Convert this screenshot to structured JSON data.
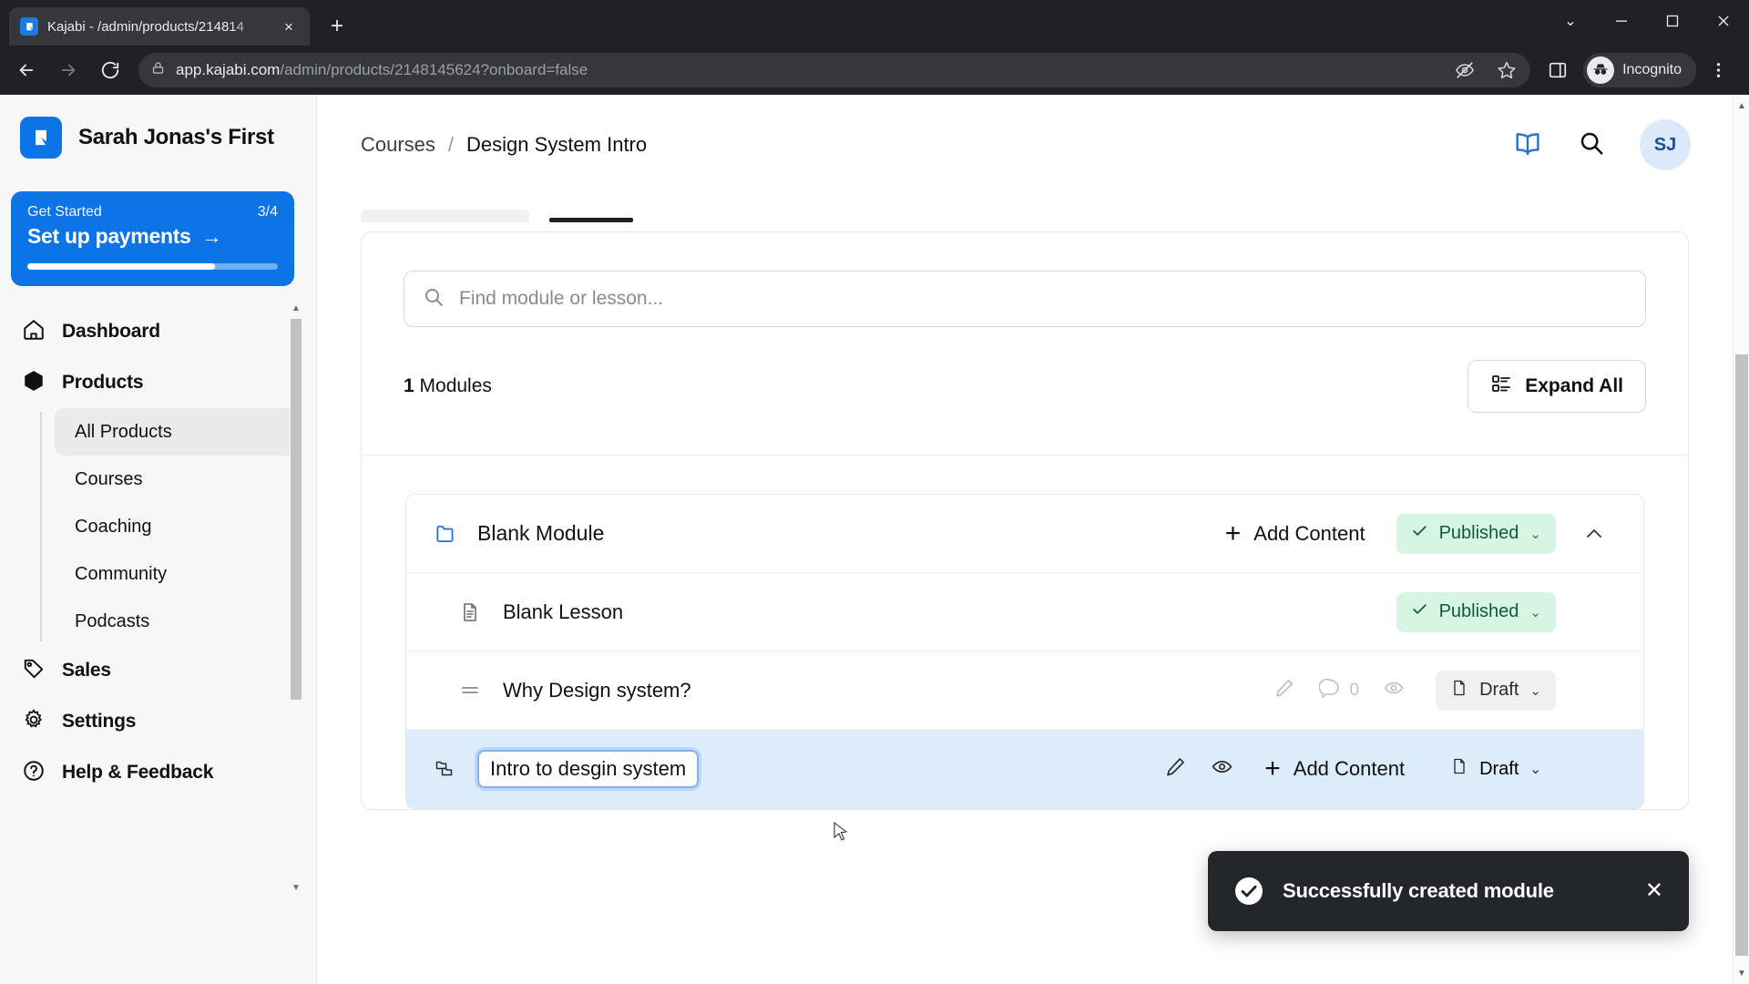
{
  "browser": {
    "tab": {
      "title": "Kajabi - /admin/products/214814",
      "favicon": "kajabi-logo-icon",
      "close": "×"
    },
    "new_tab_label": "+",
    "window_controls": {
      "minimize": "–",
      "maximize": "▢",
      "close": "✕",
      "chevron": "⌄"
    },
    "url": {
      "secure_icon": "lock-icon",
      "domain": "app.kajabi.com",
      "path": "/admin/products/2148145624?onboard=false"
    },
    "toolbar": {
      "tracking_protection": "eye-slash-icon",
      "bookmark": "star-icon",
      "side_panel": "side-panel-icon",
      "profile_label": "Incognito",
      "menu": "kebab-menu-icon"
    }
  },
  "sidebar": {
    "brand": "Sarah Jonas's First",
    "get_started": {
      "label": "Get Started",
      "count": "3/4",
      "title": "Set up payments",
      "arrow": "→",
      "progress_pct": 75,
      "accent": "#0d74e7"
    },
    "items": [
      {
        "label": "Dashboard",
        "icon": "home-icon"
      },
      {
        "label": "Products",
        "icon": "box-icon"
      },
      {
        "label": "Sales",
        "icon": "tag-icon"
      },
      {
        "label": "Settings",
        "icon": "gear-icon"
      },
      {
        "label": "Help & Feedback",
        "icon": "question-circle-icon"
      }
    ],
    "sub_items": [
      {
        "label": "All Products",
        "active": true
      },
      {
        "label": "Courses",
        "active": false
      },
      {
        "label": "Coaching",
        "active": false
      },
      {
        "label": "Community",
        "active": false
      },
      {
        "label": "Podcasts",
        "active": false
      }
    ]
  },
  "header": {
    "breadcrumb": {
      "parent": "Courses",
      "separator": "/",
      "current": "Design System Intro"
    },
    "actions": {
      "book": "book-icon",
      "search": "search-icon"
    },
    "avatar_initials": "SJ"
  },
  "content": {
    "search": {
      "placeholder": "Find module or lesson...",
      "value": "",
      "icon": "search-icon"
    },
    "modules_count": "1",
    "modules_label": "Modules",
    "expand_all_label": "Expand All",
    "rows": [
      {
        "kind": "module",
        "title": "Blank Module",
        "icon": "folder-icon",
        "add_content_label": "Add Content",
        "status": "Published",
        "status_type": "published",
        "collapse_icon": "chevron-up-icon"
      },
      {
        "kind": "lesson",
        "title": "Blank Lesson",
        "icon": "document-icon",
        "status": "Published",
        "status_type": "published"
      },
      {
        "kind": "lesson",
        "title": "Why Design system?",
        "icon": "drag-handle-icon",
        "comment_count": "0",
        "status": "Draft",
        "status_type": "draft"
      },
      {
        "kind": "module-editing",
        "title": "Intro to desgin system",
        "icon": "module-copy-icon",
        "add_content_label": "Add Content",
        "status": "Draft",
        "status_type": "draft",
        "selected": true
      }
    ]
  },
  "toast": {
    "message": "Successfully created module",
    "icon": "check-circle-icon",
    "close": "✕"
  },
  "colors": {
    "accent": "#0d74e7",
    "published_bg": "#d6f5e3",
    "published_fg": "#13593a",
    "draft_bg": "#f0f0f0",
    "selected_row": "#dcecfb",
    "toast_bg": "#23262b"
  }
}
